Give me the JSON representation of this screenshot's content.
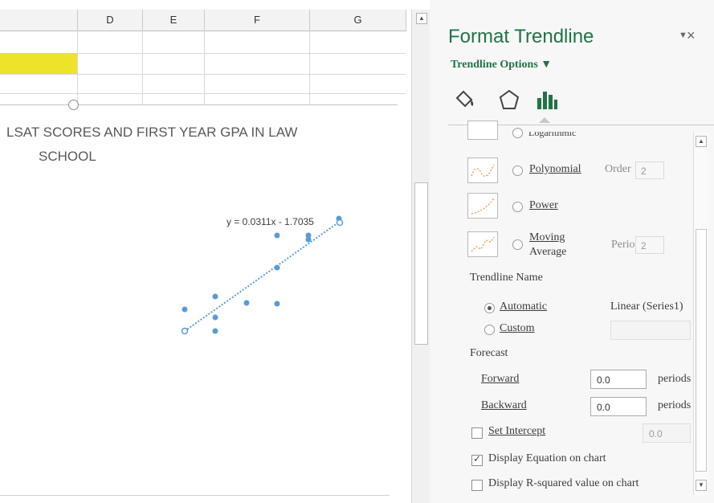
{
  "sheet": {
    "columns": [
      "D",
      "E",
      "F",
      "G"
    ]
  },
  "chart": {
    "title_line1": "LSAT SCORES AND FIRST YEAR GPA IN LAW",
    "title_line2": "SCHOOL",
    "equation": "y = 0.0311x - 1.7035",
    "marker_color": "#5b9bd5"
  },
  "pane": {
    "title": "Format Trendline",
    "subtitle": "Trendline Options ▼",
    "close_glyph": "×",
    "dropdown_glyph": "▼",
    "icons": [
      "fill-line-icon",
      "effects-icon",
      "trendline-options-icon"
    ],
    "types": {
      "logarithmic": "Logarithmic",
      "polynomial": "Polynomial",
      "power": "Power",
      "moving_average_1": "Moving",
      "moving_average_2": "Average"
    },
    "order_label": "Order",
    "order_value": "2",
    "period_label": "Period",
    "period_value": "2",
    "trendline_name": {
      "heading": "Trendline Name",
      "automatic": "Automatic",
      "automatic_value": "Linear (Series1)",
      "custom": "Custom"
    },
    "forecast": {
      "heading": "Forecast",
      "forward_label": "Forward",
      "forward_value": "0.0",
      "backward_label": "Backward",
      "backward_value": "0.0",
      "unit": "periods"
    },
    "set_intercept": {
      "label": "Set Intercept",
      "value": "0.0",
      "checked": false
    },
    "display_equation": {
      "label": "Display Equation on chart",
      "checked": true
    },
    "display_rsquared": {
      "label": "Display R-squared value on chart",
      "checked": false
    },
    "accent_color": "#217346"
  }
}
